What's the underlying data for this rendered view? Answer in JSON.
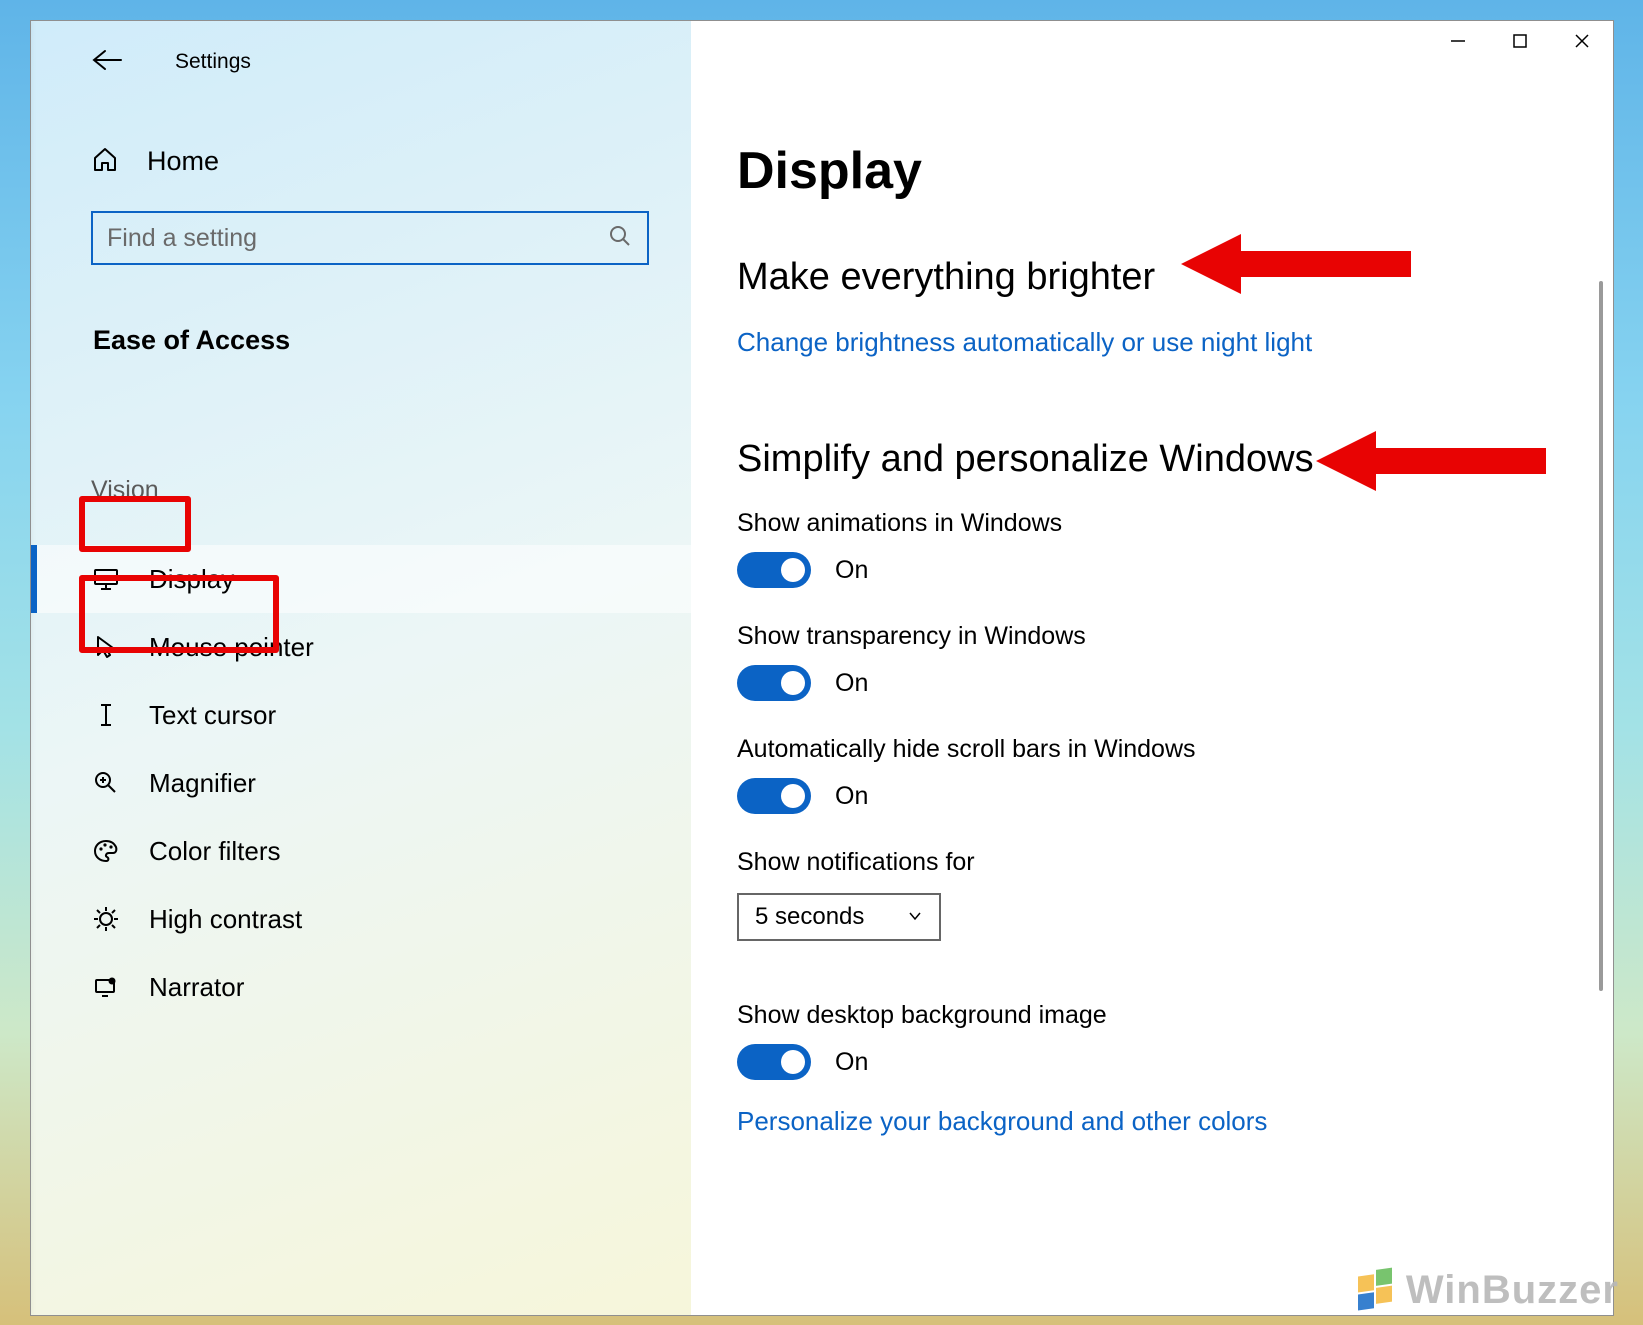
{
  "window": {
    "title": "Settings",
    "home": "Home",
    "search_placeholder": "Find a setting",
    "section": "Ease of Access"
  },
  "sidebar": {
    "group": "Vision",
    "items": [
      {
        "label": "Display",
        "icon": "display-icon",
        "active": true
      },
      {
        "label": "Mouse pointer",
        "icon": "mouse-pointer-icon",
        "active": false
      },
      {
        "label": "Text cursor",
        "icon": "text-cursor-icon",
        "active": false
      },
      {
        "label": "Magnifier",
        "icon": "magnifier-icon",
        "active": false
      },
      {
        "label": "Color filters",
        "icon": "palette-icon",
        "active": false
      },
      {
        "label": "High contrast",
        "icon": "contrast-icon",
        "active": false
      },
      {
        "label": "Narrator",
        "icon": "narrator-icon",
        "active": false
      }
    ]
  },
  "content": {
    "title": "Display",
    "sec1": {
      "heading": "Make everything brighter",
      "link": "Change brightness automatically or use night light"
    },
    "sec2": {
      "heading": "Simplify and personalize Windows",
      "opt1": {
        "label": "Show animations in Windows",
        "state": "On"
      },
      "opt2": {
        "label": "Show transparency in Windows",
        "state": "On"
      },
      "opt3": {
        "label": "Automatically hide scroll bars in Windows",
        "state": "On"
      },
      "opt4": {
        "label": "Show notifications for",
        "value": "5 seconds"
      },
      "opt5": {
        "label": "Show desktop background image",
        "state": "On"
      },
      "link": "Personalize your background and other colors"
    }
  },
  "watermark": "WinBuzzer"
}
